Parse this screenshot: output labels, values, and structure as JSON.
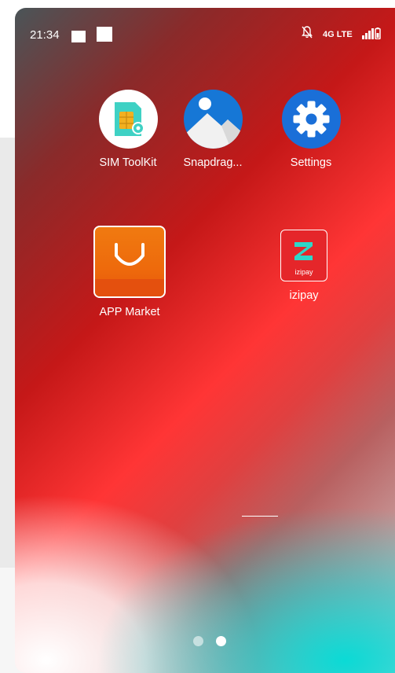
{
  "status_bar": {
    "time": "21:34",
    "network": "4G LTE",
    "icons": [
      "square-icon",
      "square-icon",
      "bell-muted-icon",
      "signal-icon",
      "battery-icon"
    ]
  },
  "home": {
    "row1": [
      {
        "label": "SIM ToolKit",
        "icon": "sim-card-icon"
      },
      {
        "label": "Snapdrag...",
        "icon": "gallery-icon"
      },
      {
        "label": "Settings",
        "icon": "gear-icon"
      }
    ],
    "row2": [
      {
        "label": "APP Market",
        "icon": "shopping-bag-icon"
      },
      {
        "label": "izipay",
        "icon": "izipay-icon",
        "icon_text": "izipay"
      }
    ]
  },
  "pager": {
    "pages": 2,
    "current": 2
  },
  "colors": {
    "izipay_red": "#e5262a",
    "market_orange": "#f07a10",
    "settings_blue": "#1a6fd8",
    "sim_teal": "#3fd1c4"
  }
}
